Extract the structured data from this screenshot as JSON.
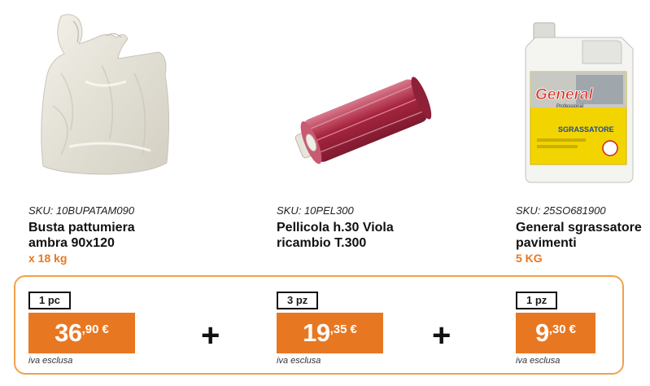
{
  "products": [
    {
      "sku": "SKU: 10BUPATAM090",
      "name_line1": "Busta pattumiera",
      "name_line2": "ambra 90x120",
      "qty": "x 18 kg",
      "unit": "1 pc",
      "price_int": "36",
      "price_dec": ",90",
      "currency": "€",
      "vat": "iva esclusa"
    },
    {
      "sku": "SKU: 10PEL300",
      "name_line1": "Pellicola h.30 Viola",
      "name_line2": "ricambio T.300",
      "qty": "",
      "unit": "3 pz",
      "price_int": "19",
      "price_dec": ",35",
      "currency": "€",
      "vat": "iva esclusa"
    },
    {
      "sku": "SKU: 25SO681900",
      "name_line1": "General sgrassatore",
      "name_line2": "pavimenti",
      "qty": "5 KG",
      "unit": "1 pz",
      "price_int": "9",
      "price_dec": ",30",
      "currency": "€",
      "vat": "iva esclusa"
    }
  ],
  "plus_sign": "+",
  "product_images": {
    "p0": "trash-bag-image",
    "p1": "stretch-film-roll-image",
    "p2": "detergent-canister-image",
    "bottle_brand": "General",
    "bottle_sub": "Professional",
    "bottle_label": "SGRASSATORE"
  },
  "colors": {
    "accent": "#e87722",
    "border": "#f0a24a",
    "film": "#a8243e"
  }
}
